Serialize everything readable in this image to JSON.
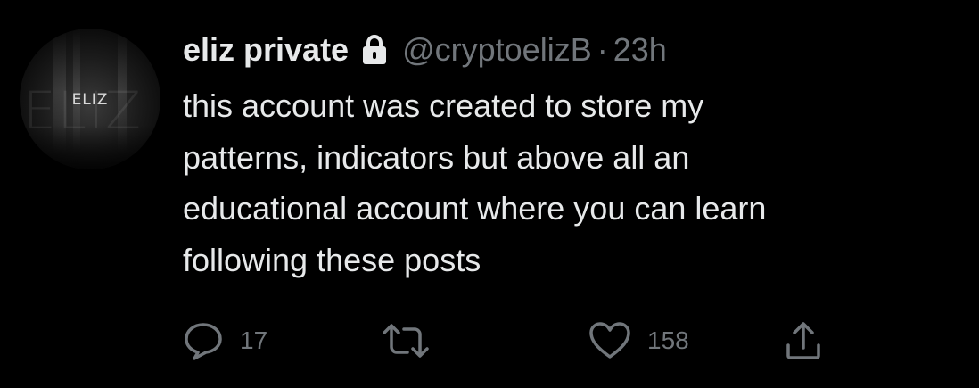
{
  "tweet": {
    "avatar": {
      "text": "ELIZ",
      "background_letters": "ELIZ"
    },
    "author": {
      "display_name": "eliz private",
      "protected_icon": "lock-icon",
      "handle": "@cryptoelizB",
      "separator": "·",
      "time": "23h"
    },
    "text": "this account was created to store my\npatterns, indicators but above all an\neducational account where you can learn\nfollowing these posts",
    "actions": {
      "reply": {
        "icon": "reply-icon",
        "count": "17"
      },
      "retweet": {
        "icon": "retweet-icon",
        "count": ""
      },
      "like": {
        "icon": "heart-icon",
        "count": "158"
      },
      "share": {
        "icon": "share-icon"
      }
    }
  },
  "colors": {
    "background": "#000000",
    "primary_text": "#e7e9ea",
    "secondary_text": "#71767b"
  }
}
